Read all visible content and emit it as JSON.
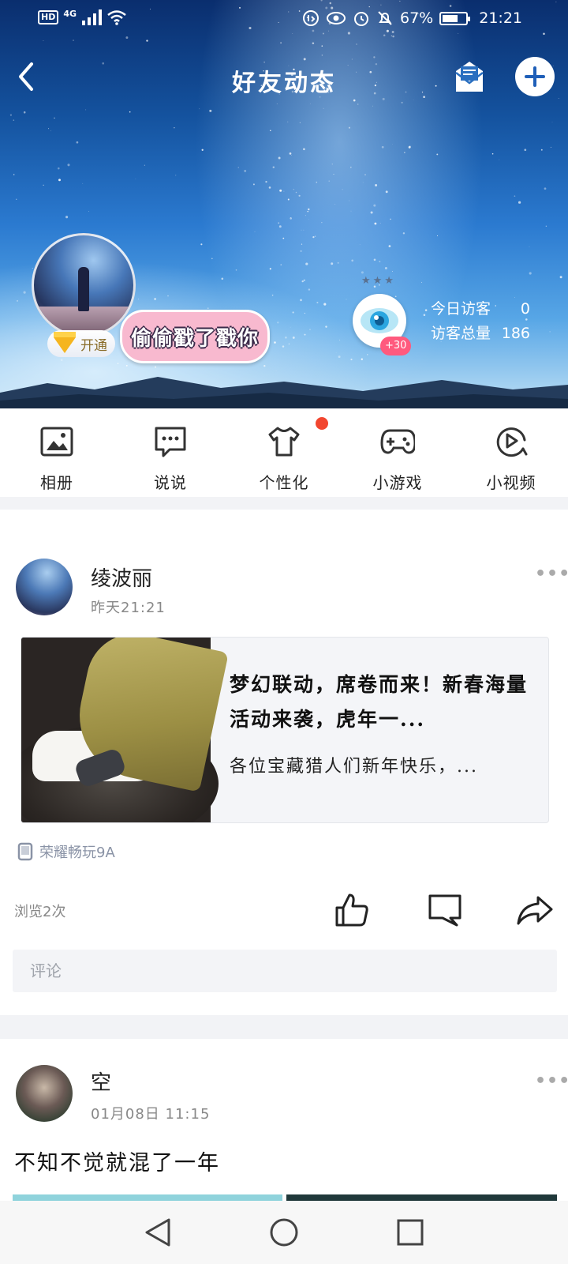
{
  "status_bar": {
    "network_badge": "HD",
    "network_type": "4G",
    "battery_percent": "67%",
    "battery_level": 0.67,
    "time": "21:21"
  },
  "header": {
    "title": "好友动态",
    "back_icon": "chevron-left-icon",
    "mail_icon": "mail-icon",
    "add_icon": "plus-icon"
  },
  "profile": {
    "vip_label": "开通",
    "sticker_text": "偷偷戳了戳你",
    "visitor_bonus": "+30",
    "visitors_today_label": "今日访客",
    "visitors_today": "0",
    "visitors_total_label": "访客总量",
    "visitors_total": "186"
  },
  "quick_menu": [
    {
      "label": "相册",
      "icon": "image-icon"
    },
    {
      "label": "说说",
      "icon": "chat-bubble-icon"
    },
    {
      "label": "个性化",
      "icon": "shirt-icon"
    },
    {
      "label": "小游戏",
      "icon": "gamepad-icon"
    },
    {
      "label": "小视频",
      "icon": "play-circle-icon"
    }
  ],
  "posts": [
    {
      "author": "绫波丽",
      "time": "昨天21:21",
      "share_title": "梦幻联动，席卷而来！新春海量活动来袭，虎年一...",
      "share_desc": "各位宝藏猎人们新年快乐，...",
      "device": "荣耀畅玩9A",
      "views": "浏览2次",
      "comment_placeholder": "评论"
    },
    {
      "author": "空",
      "time": "01月08日 11:15",
      "text": "不知不觉就混了一年"
    }
  ],
  "colors": {
    "accent_red": "#f2462f",
    "badge_pink": "#ff5a7e",
    "sky_blue": "#2b7ad0"
  }
}
